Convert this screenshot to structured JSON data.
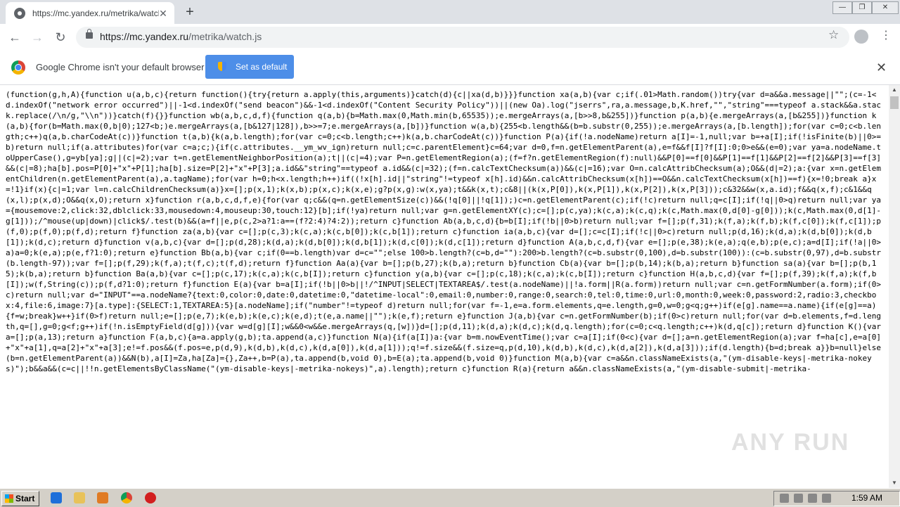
{
  "tab": {
    "title": "https://mc.yandex.ru/metrika/watch.js",
    "close": "✕",
    "new_tab": "+"
  },
  "window": {
    "minimize": "—",
    "restore": "❐",
    "close": "✕"
  },
  "toolbar": {
    "back": "←",
    "forward": "→",
    "reload": "↻",
    "url_host": "https://mc.yandex.ru",
    "url_path": "/metrika/watch.js",
    "star": "☆",
    "menu": "⋮"
  },
  "infobar": {
    "message": "Google Chrome isn't your default browser",
    "button_label": "Set as default",
    "close": "✕"
  },
  "code_text": "(function(g,h,A){function u(a,b,c){return function(){try{return a.apply(this,arguments)}catch(d){c||xa(d,b)}}}function xa(a,b){var c;if(.01>Math.random())try{var d=a&&a.message||\"\";(c=-1<d.indexOf(\"network error occurred\")||-1<d.indexOf(\"send beacon\")&&-1<d.indexOf(\"Content Security Policy\"))||(new Oa).log(\"jserrs\",ra,a.message,b,K.href,\"\",\"string\"===typeof a.stack&&a.stack.replace(/\\n/g,\"\\\\n\"))}catch(f){}}function wb(a,b,c,d,f){function q(a,b){b=Math.max(0,Math.min(b,65535));e.mergeArrays(a,[b>>8,b&255])}function p(a,b){e.mergeArrays(a,[b&255])}function k(a,b){for(b=Math.max(0,b|0);127<b;)e.mergeArrays(a,[b&127|128]),b>>=7;e.mergeArrays(a,[b])}function w(a,b){255<b.length&&(b=b.substr(0,255));e.mergeArrays(a,[b.length]);for(var c=0;c<b.length;c++)q(a,b.charCodeAt(c))}function t(a,b){k(a,b.length);for(var c=0;c<b.length;c++)k(a,b.charCodeAt(c))}function P(a){if(!a.nodeName)return a[I]=-1,null;var b=+a[I];if(!isFinite(b)||0>=b)return null;if(a.attributes)for(var c=a;c;){if(c.attributes.__ym_wv_ign)return null;c=c.parentElement}c=64;var d=0,f=n.getElementParent(a),e=f&&f[I]?f[I]:0;0>e&&(e=0);var ya=a.nodeName.toUpperCase(),g=yb[ya];g||(c|=2);var t=n.getElementNeighborPosition(a);t||(c|=4);var P=n.getElementRegion(a);(f=f?n.getElementRegion(f):null)&&P[0]==f[0]&&P[1]==f[1]&&P[2]==f[2]&&P[3]==f[3]&&(c|=8);ha[b].pos=P[0]+\"x\"+P[1];ha[b].size=P[2]+\"x\"+P[3];a.id&&\"string\"==typeof a.id&&(c|=32);(f=n.calcTextChecksum(a))&&(c|=16);var O=n.calcAttribChecksum(a);O&&(d|=2);a:{var x=n.getElementChildren(n.getElementParent(a),a.tagName);for(var h=0;h<x.length;h++)if((!x[h].id||\"string\"!=typeof x[h].id)&&n.calcAttribChecksum(x[h])==O&&n.calcTextChecksum(x[h])==f){x=!0;break a}x=!1}if(x){c|=1;var l=n.calcChildrenChecksum(a)}x=[];p(x,1);k(x,b);p(x,c);k(x,e);g?p(x,g):w(x,ya);t&&k(x,t);c&8||(k(x,P[0]),k(x,P[1]),k(x,P[2]),k(x,P[3]));c&32&&w(x,a.id);f&&q(x,f);c&1&&q(x,l);p(x,d);O&&q(x,O);return x}function r(a,b,c,d,f,e){for(var q;c&&(q=n.getElementSize(c))&&(!q[0]||!q[1]);)c=n.getElementParent(c);if(!c)return null;q=c[I];if(!q||0>q)return null;var ya={mousemove:2,click:32,dblclick:33,mousedown:4,mouseup:30,touch:12}[b];if(!ya)return null;var g=n.getElementXY(c);c=[];p(c,ya);k(c,a);k(c,q);k(c,Math.max(0,d[0]-g[0]));k(c,Math.max(0,d[1]-g[1]));/^mouse(up|down)|click$/.test(b)&&(a=f||e,p(c,2>a?1:a==(f?2:4)?4:2));return c}function Ab(a,b,c,d){b=b[I];if(!b||0>b)return null;var f=[];p(f,31);k(f,a);k(f,b);k(f,c[0]);k(f,c[1]);p(f,0);p(f,0);p(f,d);return f}function za(a,b){var c=[];p(c,3);k(c,a);k(c,b[0]);k(c,b[1]);return c}function ia(a,b,c){var d=[];c=c[I];if(!c||0>c)return null;p(d,16);k(d,a);k(d,b[0]);k(d,b[1]);k(d,c);return d}function v(a,b,c){var d=[];p(d,28);k(d,a);k(d,b[0]);k(d,b[1]);k(d,c[0]);k(d,c[1]);return d}function A(a,b,c,d,f){var e=[];p(e,38);k(e,a);q(e,b);p(e,c);a=d[I];if(!a||0>a)a=0;k(e,a);p(e,f?1:0);return e}function Bb(a,b){var c;if(0==b.length)var d=c=\"\";else 100>b.length?(c=b,d=\"\"):200>b.length?(c=b.substr(0,100),d=b.substr(100)):(c=b.substr(0,97),d=b.substr(b.length-97));var f=[];p(f,29);k(f,a);t(f,c);t(f,d);return f}function Aa(a){var b=[];p(b,27);k(b,a);return b}function Cb(a){var b=[];p(b,14);k(b,a);return b}function sa(a){var b=[];p(b,15);k(b,a);return b}function Ba(a,b){var c=[];p(c,17);k(c,a);k(c,b[I]);return c}function y(a,b){var c=[];p(c,18);k(c,a);k(c,b[I]);return c}function H(a,b,c,d){var f=[];p(f,39);k(f,a);k(f,b[I]);w(f,String(c));p(f,d?1:0);return f}function E(a){var b=a[I];if(!b||0>b||!/^INPUT|SELECT|TEXTAREA$/.test(a.nodeName)||!a.form||R(a.form))return null;var c=n.getFormNumber(a.form);if(0>c)return null;var d=\"INPUT\"==a.nodeName?{text:0,color:0,date:0,datetime:0,\"datetime-local\":0,email:0,number:0,range:0,search:0,tel:0,time:0,url:0,month:0,week:0,password:2,radio:3,checkbox:4,file:6,image:7}[a.type]:{SELECT:1,TEXTAREA:5}[a.nodeName];if(\"number\"!=typeof d)return null;for(var f=-1,e=a.form.elements,q=e.length,g=0,w=0;g<q;g++)if(e[g].name==a.name){if(e[g]==a){f=w;break}w++}if(0>f)return null;e=[];p(e,7);k(e,b);k(e,c);k(e,d);t(e,a.name||\"\");k(e,f);return e}function J(a,b){var c=n.getFormNumber(b);if(0>c)return null;for(var d=b.elements,f=d.length,q=[],g=0;g<f;g++)if(!n.isEmptyField(d[g])){var w=d[g][I];w&&0<w&&e.mergeArrays(q,[w])}d=[];p(d,11);k(d,a);k(d,c);k(d,q.length);for(c=0;c<q.length;c++)k(d,q[c]);return d}function K(){var a=[];p(a,13);return a}function F(a,b,c){a=a.apply(g,b);ta.append(a,c)}function N(a){if(a[I])a:{var b=m.nowEventTime();var c=a[I];if(0<c){var d=[];a=n.getElementRegion(a);var f=ha[c],e=a[0]+\"x\"+a[1],q=a[2]+\"x\"+a[3];e!=f.pos&&(f.pos=e,p(d,9),k(d,b),k(d,c),k(d,a[0]),k(d,a[1]));q!=f.size&&(f.size=q,p(d,10),k(d,b),k(d,c),k(d,a[2]),k(d,a[3]));if(d.length){b=d;break a}}b=null}else(b=n.getElementParent(a))&&N(b),a[I]=Za,ha[Za]={},Za++,b=P(a),ta.append(b,void 0),b=E(a);ta.append(b,void 0)}function M(a,b){var c=a&&n.classNameExists(a,\"(ym-disable-keys|-metrika-nokeys)\");b&&a&&(c=c||!!n.getElementsByClassName(\"(ym-disable-keys|-metrika-nokeys)\",a).length);return c}function R(a){return a&&n.classNameExists(a,\"(ym-disable-submit|-metrika-",
  "watermark": "ANY RUN",
  "taskbar": {
    "start_label": "Start",
    "clock": "1:59 AM"
  }
}
